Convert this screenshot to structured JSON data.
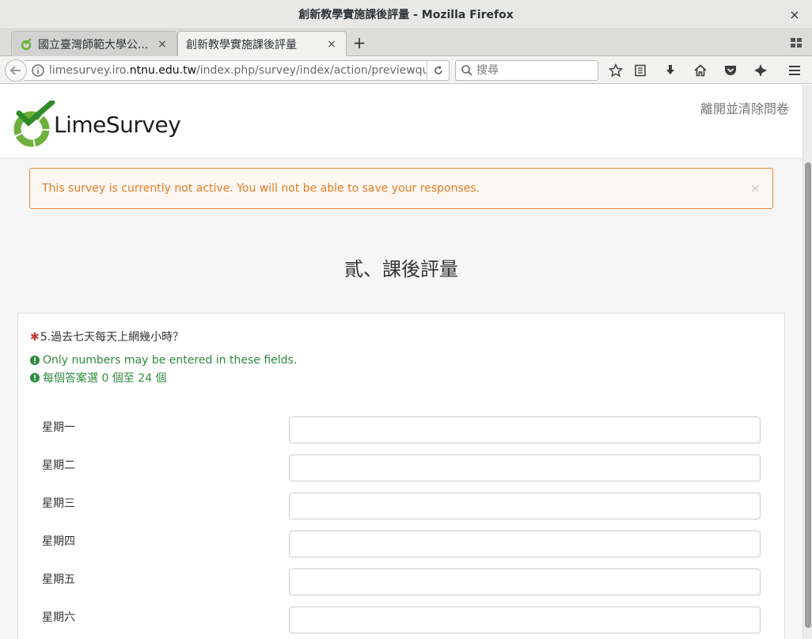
{
  "window": {
    "title": "創新教學實施課後評量 - Mozilla Firefox",
    "close_glyph": "×"
  },
  "tabs": [
    {
      "label": "國立臺灣師範大學公...",
      "active": false
    },
    {
      "label": "創新教學實施課後評量",
      "active": true
    }
  ],
  "tab_close_glyph": "×",
  "newtab_glyph": "+",
  "navbar": {
    "url_host_prefix": "limesurvey.iro.",
    "url_host": "ntnu.edu.tw",
    "url_path": "/index.php/survey/index/action/previewque",
    "search_placeholder": "搜尋"
  },
  "page": {
    "brand": "LimeSurvey",
    "exit_link": "離開並清除問卷",
    "alert_text": "This survey is currently not active. You will not be able to save your responses.",
    "alert_close": "×",
    "group_title": "貳、課後評量",
    "question": {
      "required_mark": "✱",
      "text": "5.過去七天每天上網幾小時？",
      "tips": [
        "Only numbers may be entered in these fields.",
        "每個答案選 0 個至 24 個"
      ],
      "rows": [
        {
          "label": "星期一",
          "value": ""
        },
        {
          "label": "星期二",
          "value": ""
        },
        {
          "label": "星期三",
          "value": ""
        },
        {
          "label": "星期四",
          "value": ""
        },
        {
          "label": "星期五",
          "value": ""
        },
        {
          "label": "星期六",
          "value": ""
        }
      ]
    }
  },
  "colors": {
    "alert_border": "#e58a3e",
    "alert_text": "#e27e2a",
    "tip_green": "#2e8b3e",
    "brand_green": "#6fb03d"
  }
}
